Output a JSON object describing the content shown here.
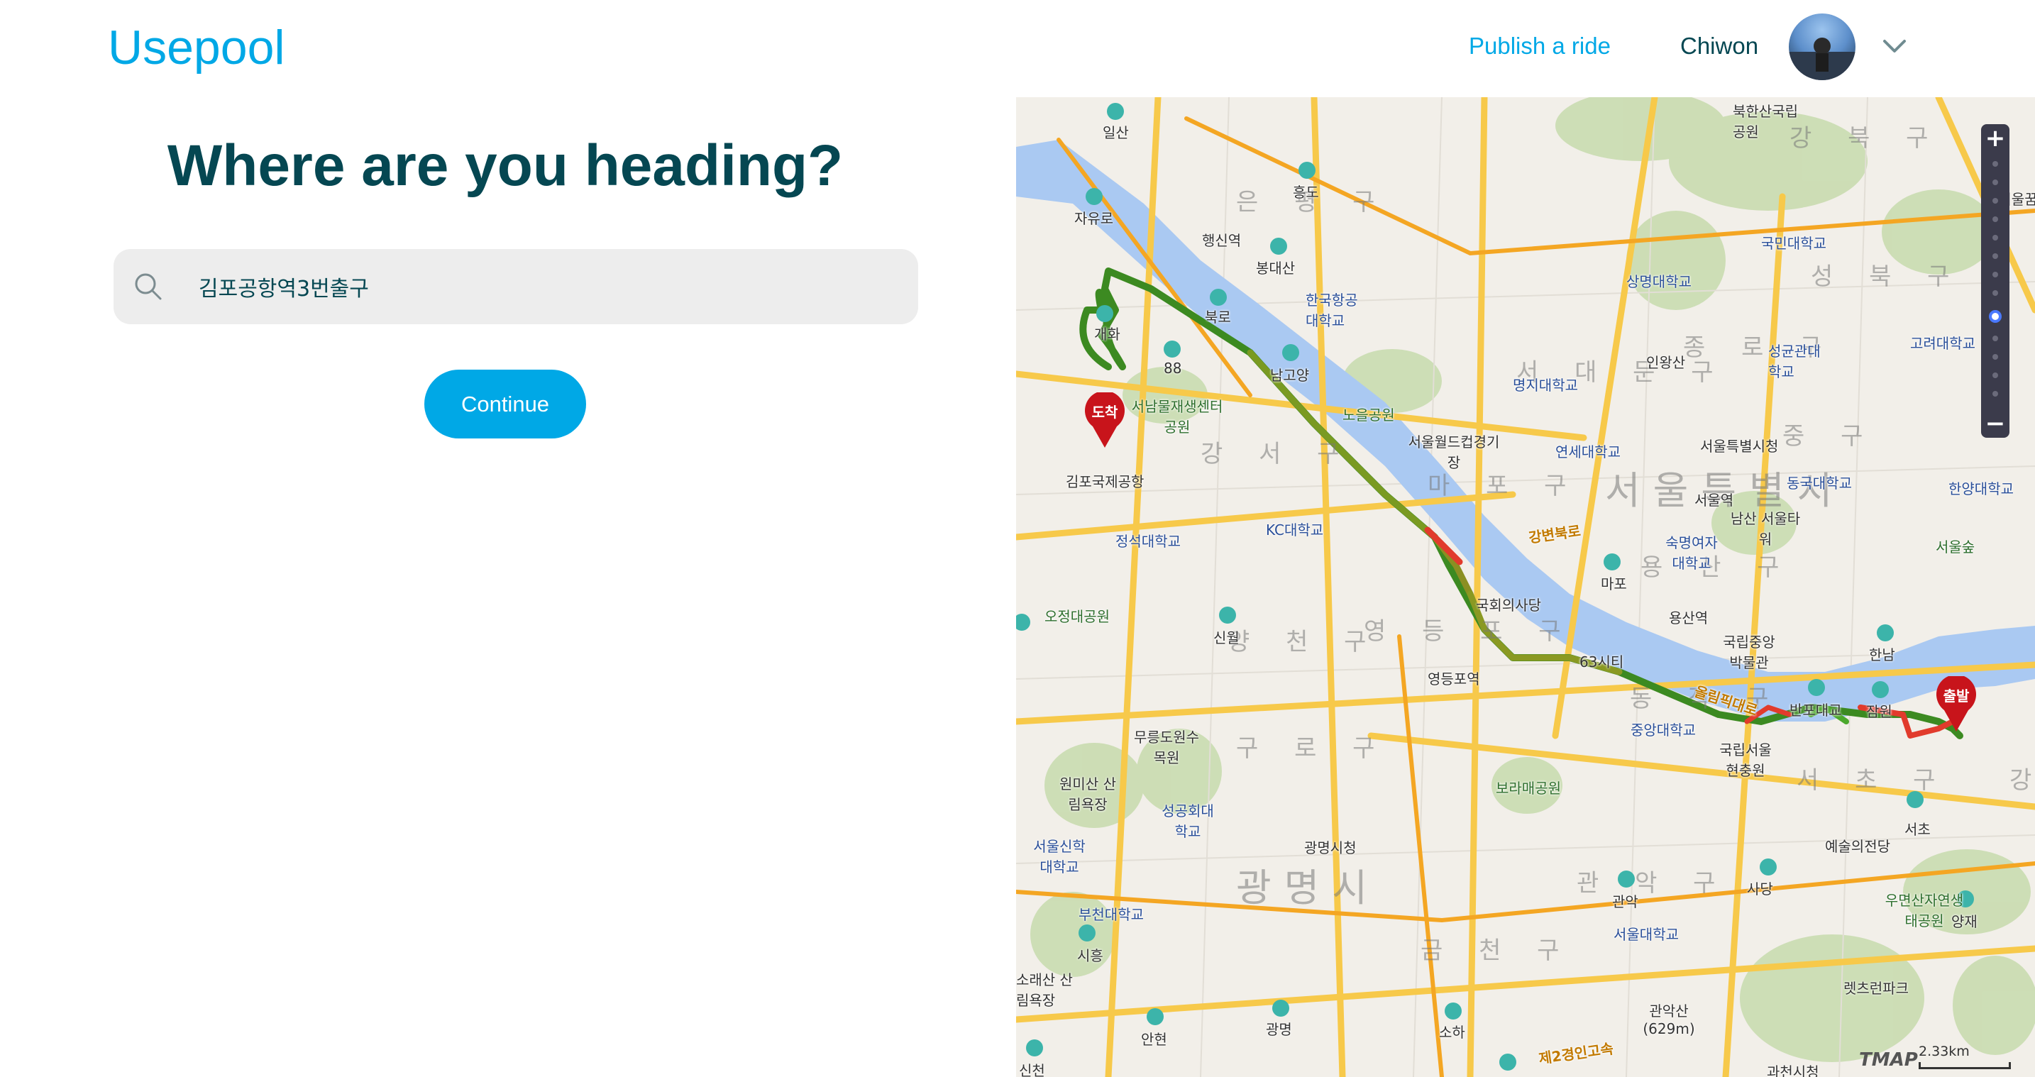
{
  "header": {
    "logo": "Usepool",
    "publish_label": "Publish a ride",
    "username": "Chiwon"
  },
  "main": {
    "headline": "Where are you heading?",
    "search_value": "김포공항역3번출구",
    "continue_label": "Continue"
  },
  "map": {
    "brand": "TMAP",
    "scale_label": "2.33km",
    "districts": [
      "은 평 구",
      "강 북 구",
      "성 북 구",
      "종 로 구",
      "서 대 문 구",
      "마 포 구",
      "중 구",
      "용 산 구",
      "강 서 구",
      "양 천 구",
      "영 등 포 구",
      "동 작 구",
      "구 로 구",
      "관 악 구",
      "금 천 구",
      "서 초 구",
      "강"
    ],
    "city_names": [
      "서울특별시",
      "광명시"
    ],
    "places": {
      "ilsan": "일산",
      "jayuro": "자유로",
      "haengsin": "행신역",
      "heungdo": "흥도",
      "bongdaesan": "봉대산",
      "kau": "한국항공대학교",
      "bukhansan": "북한산국립공원",
      "gukmin": "국민대학교",
      "sangmyung": "상명대학교",
      "bukseoul": "북서울꿈",
      "goryeo": "고려대학교",
      "sungkyunkwan": "성균관대학교",
      "inwangsan": "인왕산",
      "myongji": "명지대학교",
      "bukro": "북로",
      "gaehwa": "개화",
      "n88": "88",
      "namgoyang": "남고양",
      "seonam": "서남물재생센터 공원",
      "noeul": "노을공원",
      "worldcup": "서울월드컵경기장",
      "yonsei": "연세대학교",
      "cityhall": "서울특별시청",
      "dongguk": "동국대학교",
      "hanyang": "한양대학교",
      "arrival": "도착",
      "departure": "출발",
      "gimpo_airport": "김포국제공항",
      "seoul_station": "서울역",
      "namsan": "남산 서울타워",
      "sookmyung": "숙명여자대학교",
      "seoulforest": "서울숲",
      "jeongseok": "정석대학교",
      "kc": "KC대학교",
      "mapo": "마포",
      "assembly": "국회의사당",
      "yongsan": "용산역",
      "museum": "국립중앙박물관",
      "hannam": "한남",
      "ojeong": "오정대공원",
      "sinwol": "신월",
      "yeongdeungpo": "영등포역",
      "n63": "63시티",
      "jungang": "중앙대학교",
      "banpo": "반포대교",
      "jamwon": "잠원",
      "hyeonchungwon": "국립서울현충원",
      "gangbyeon": "강변북로",
      "olympic": "올림픽대로",
      "mureungdowon": "무릉도원수목원",
      "wonmisan": "원미산 산림욕장",
      "sunggonghoe": "성공회대학교",
      "boramae": "보라매공원",
      "seocho": "서초",
      "arts": "예술의전당",
      "seoulsinhak": "서울신학대학교",
      "gwangmyeong_hall": "광명시청",
      "sadang": "사당",
      "umyeonsan": "우면산자연생태공원",
      "bucheon": "부천대학교",
      "siheung": "시흥",
      "gwanak": "관악",
      "snu": "서울대학교",
      "yangjae": "양재",
      "sorae": "소래산 산림욕장",
      "anhyeon": "안현",
      "gwangmyeong": "광명",
      "soha": "소하",
      "gwanaksan": "관악산 (629m)",
      "lets": "렛츠런파크",
      "sinchon": "신천",
      "ring2": "제2경인고속",
      "gwacheon": "과천시청"
    }
  }
}
